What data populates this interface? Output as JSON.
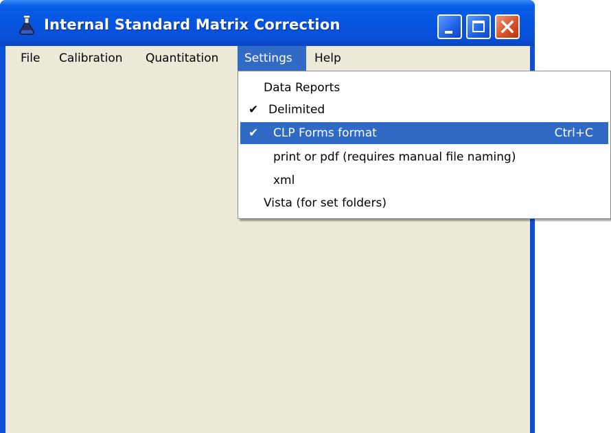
{
  "window": {
    "title": "Internal Standard Matrix Correction",
    "icon": "flask-icon",
    "buttons": [
      "minimize-icon",
      "maximize-icon",
      "close-icon"
    ]
  },
  "menubar": {
    "items": [
      {
        "label": "File"
      },
      {
        "label": "Calibration"
      },
      {
        "label": "Quantitation"
      },
      {
        "label": "Settings",
        "active": true
      },
      {
        "label": "Help"
      }
    ]
  },
  "settings_menu": {
    "items": [
      {
        "label": "Data Reports",
        "checked": false
      },
      {
        "label": "Delimited",
        "checked": true
      },
      {
        "label": "CLP Forms format",
        "checked": true,
        "shortcut": "Ctrl+C",
        "highlighted": true
      },
      {
        "label": "print or pdf (requires manual file naming)",
        "checked": false
      },
      {
        "label": "xml",
        "checked": false
      },
      {
        "label": "Vista (for set folders)",
        "checked": false
      }
    ]
  },
  "colors": {
    "titlebar": "#0654e0",
    "menu_highlight": "#316ac5",
    "client_bg": "#ece9d8",
    "close_button": "#d9512b"
  }
}
